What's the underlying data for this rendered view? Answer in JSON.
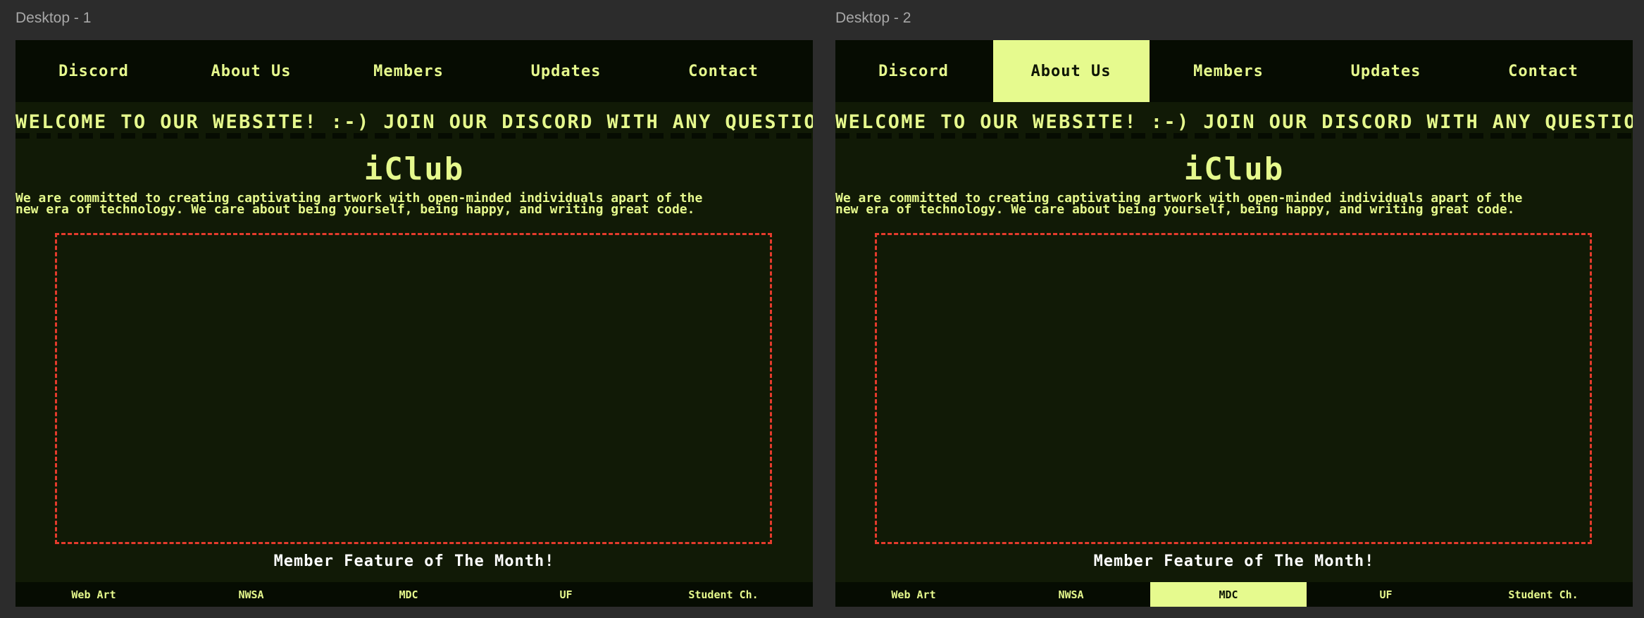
{
  "frames": [
    {
      "label": "Desktop - 1",
      "nav": [
        "Discord",
        "About Us",
        "Members",
        "Updates",
        "Contact"
      ],
      "active_nav": -1,
      "marquee": "WELCOME TO OUR WEBSITE! :-) JOIN OUR DISCORD WITH ANY QUESTIONS!",
      "title": "iClub",
      "description_line1": "We are committed to creating captivating artwork with open-minded individuals apart of the",
      "description_line2": "new era of technology. We care about being yourself, being happy, and writing great code.",
      "feature_caption": "Member Feature of The Month!",
      "footer": [
        "Web Art",
        "NWSA",
        "MDC",
        "UF",
        "Student Ch."
      ],
      "active_footer": -1
    },
    {
      "label": "Desktop - 2",
      "nav": [
        "Discord",
        "About Us",
        "Members",
        "Updates",
        "Contact"
      ],
      "active_nav": 1,
      "marquee": "WELCOME TO OUR WEBSITE! :-) JOIN OUR DISCORD WITH ANY QUESTIONS!",
      "title": "iClub",
      "description_line1": "We are committed to creating captivating artwork with open-minded individuals apart of the",
      "description_line2": "new era of technology. We care about being yourself, being happy, and writing great code.",
      "feature_caption": "Member Feature of The Month!",
      "footer": [
        "Web Art",
        "NWSA",
        "MDC",
        "UF",
        "Student Ch."
      ],
      "active_footer": 2
    }
  ],
  "colors": {
    "canvas_bg": "#2c2c2c",
    "page_bg": "#111a06",
    "nav_bg": "#060c02",
    "accent": "#e6fa8e",
    "feature_border": "#e43b2c"
  }
}
